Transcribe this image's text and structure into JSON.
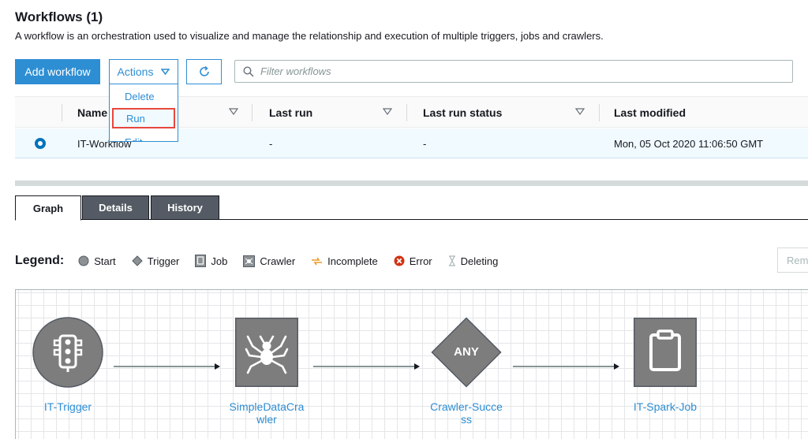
{
  "page": {
    "title": "Workflows (1)",
    "subtitle": "A workflow is an orchestration used to visualize and manage the relationship and execution of multiple triggers, jobs and crawlers."
  },
  "toolbar": {
    "add_label": "Add workflow",
    "actions_label": "Actions",
    "filter_placeholder": "Filter workflows"
  },
  "actions_menu": {
    "items": [
      "Delete",
      "Run",
      "Edit"
    ]
  },
  "table": {
    "columns": [
      "Name",
      "Last run",
      "Last run status",
      "Last modified"
    ],
    "rows": [
      {
        "name": "IT-Workflow",
        "last_run": "-",
        "last_run_status": "-",
        "last_modified": "Mon, 05 Oct 2020 11:06:50 GMT",
        "selected": true
      }
    ]
  },
  "tabs": [
    "Graph",
    "Details",
    "History"
  ],
  "legend": {
    "title": "Legend:",
    "items": [
      {
        "label": "Start",
        "icon": "start-circle-icon"
      },
      {
        "label": "Trigger",
        "icon": "trigger-diamond-icon"
      },
      {
        "label": "Job",
        "icon": "job-icon"
      },
      {
        "label": "Crawler",
        "icon": "crawler-icon"
      },
      {
        "label": "Incomplete",
        "icon": "incomplete-icon"
      },
      {
        "label": "Error",
        "icon": "error-icon"
      },
      {
        "label": "Deleting",
        "icon": "hourglass-icon"
      }
    ],
    "remove_label": "Rem"
  },
  "graph": {
    "nodes": [
      {
        "label_line1": "IT-Trigger",
        "label_line2": "",
        "icon": "traffic-light-icon"
      },
      {
        "label_line1": "SimpleDataCra",
        "label_line2": "wler",
        "icon": "spider-icon"
      },
      {
        "label_line1": "Crawler-Succe",
        "label_line2": "ss",
        "icon": "any-diamond-icon",
        "inner_text": "ANY"
      },
      {
        "label_line1": "IT-Spark-Job",
        "label_line2": "",
        "icon": "clipboard-icon"
      }
    ]
  },
  "colors": {
    "primary": "#2e8ed3",
    "error": "#e8473d",
    "node_gray": "#7d7d7d",
    "selected_row": "#f1faff"
  }
}
